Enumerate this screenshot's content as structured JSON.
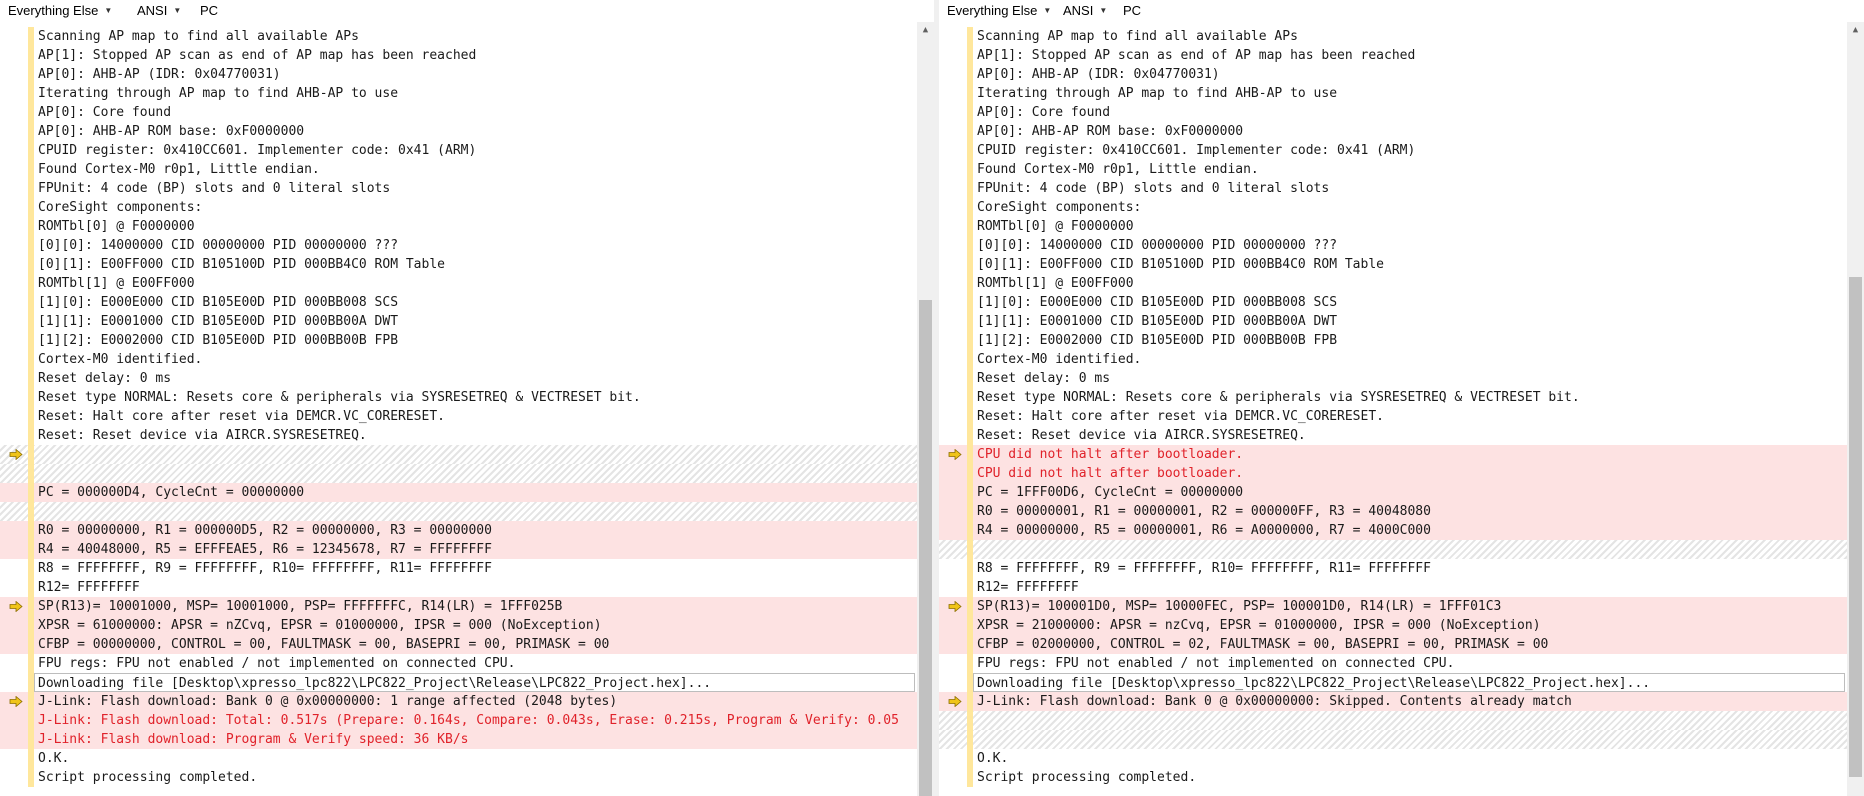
{
  "toolbar": {
    "items": [
      {
        "label": "Everything Else"
      },
      {
        "label": "ANSI"
      },
      {
        "label": "PC"
      }
    ]
  },
  "colors": {
    "marker": "#f0c419",
    "changed_bg": "#fde2e2",
    "changed_text": "#e0222a",
    "gutter_bar": "#ffe79c"
  },
  "left": {
    "lines": [
      {
        "t": "Scanning AP map to find all available APs"
      },
      {
        "t": "AP[1]: Stopped AP scan as end of AP map has been reached"
      },
      {
        "t": "AP[0]: AHB-AP (IDR: 0x04770031)"
      },
      {
        "t": "Iterating through AP map to find AHB-AP to use"
      },
      {
        "t": "AP[0]: Core found"
      },
      {
        "t": "AP[0]: AHB-AP ROM base: 0xF0000000"
      },
      {
        "t": "CPUID register: 0x410CC601. Implementer code: 0x41 (ARM)"
      },
      {
        "t": "Found Cortex-M0 r0p1, Little endian."
      },
      {
        "t": "FPUnit: 4 code (BP) slots and 0 literal slots"
      },
      {
        "t": "CoreSight components:"
      },
      {
        "t": "ROMTbl[0] @ F0000000"
      },
      {
        "t": "[0][0]: 14000000 CID 00000000 PID 00000000 ???"
      },
      {
        "t": "[0][1]: E00FF000 CID B105100D PID 000BB4C0 ROM Table"
      },
      {
        "t": "ROMTbl[1] @ E00FF000"
      },
      {
        "t": "[1][0]: E000E000 CID B105E00D PID 000BB008 SCS"
      },
      {
        "t": "[1][1]: E0001000 CID B105E00D PID 000BB00A DWT"
      },
      {
        "t": "[1][2]: E0002000 CID B105E00D PID 000BB00B FPB"
      },
      {
        "t": "Cortex-M0 identified."
      },
      {
        "t": "Reset delay: 0 ms"
      },
      {
        "t": "Reset type NORMAL: Resets core & peripherals via SYSRESETREQ & VECTRESET bit."
      },
      {
        "t": "Reset: Halt core after reset via DEMCR.VC_CORERESET."
      },
      {
        "t": "Reset: Reset device via AIRCR.SYSRESETREQ."
      },
      {
        "t": "",
        "kind": "hatched",
        "marker": true
      },
      {
        "t": "",
        "kind": "hatched"
      },
      {
        "t": "PC = 000000D4, CycleCnt = 00000000",
        "kind": "changed"
      },
      {
        "t": "",
        "kind": "hatched"
      },
      {
        "t": "R0 = 00000000, R1 = 000000D5, R2 = 00000000, R3 = 00000000",
        "kind": "changed"
      },
      {
        "t": "R4 = 40048000, R5 = EFFFEAE5, R6 = 12345678, R7 = FFFFFFFF",
        "kind": "changed"
      },
      {
        "t": "R8 = FFFFFFFF, R9 = FFFFFFFF, R10= FFFFFFFF, R11= FFFFFFFF"
      },
      {
        "t": "R12= FFFFFFFF"
      },
      {
        "t": "SP(R13)= 10001000, MSP= 10001000, PSP= FFFFFFFC, R14(LR) = 1FFF025B",
        "kind": "changed",
        "marker": true
      },
      {
        "t": "XPSR = 61000000: APSR = nZCvq, EPSR = 01000000, IPSR = 000 (NoException)",
        "kind": "changed"
      },
      {
        "t": "CFBP = 00000000, CONTROL = 00, FAULTMASK = 00, BASEPRI = 00, PRIMASK = 00",
        "kind": "changed"
      },
      {
        "t": "FPU regs: FPU not enabled / not implemented on connected CPU."
      },
      {
        "t": "Downloading file [Desktop\\xpresso_lpc822\\LPC822_Project\\Release\\LPC822_Project.hex]...",
        "kind": "box"
      },
      {
        "t": "J-Link: Flash download: Bank 0 @ 0x00000000: 1 range affected (2048 bytes)",
        "kind": "changed",
        "marker": true
      },
      {
        "t": "J-Link: Flash download: Total: 0.517s (Prepare: 0.164s, Compare: 0.043s, Erase: 0.215s, Program & Verify: 0.05",
        "kind": "changed",
        "red": true
      },
      {
        "t": "J-Link: Flash download: Program & Verify speed: 36 KB/s",
        "kind": "changed",
        "red": true
      },
      {
        "t": "O.K."
      },
      {
        "t": "Script processing completed."
      }
    ]
  },
  "right": {
    "lines": [
      {
        "t": "Scanning AP map to find all available APs"
      },
      {
        "t": "AP[1]: Stopped AP scan as end of AP map has been reached"
      },
      {
        "t": "AP[0]: AHB-AP (IDR: 0x04770031)"
      },
      {
        "t": "Iterating through AP map to find AHB-AP to use"
      },
      {
        "t": "AP[0]: Core found"
      },
      {
        "t": "AP[0]: AHB-AP ROM base: 0xF0000000"
      },
      {
        "t": "CPUID register: 0x410CC601. Implementer code: 0x41 (ARM)"
      },
      {
        "t": "Found Cortex-M0 r0p1, Little endian."
      },
      {
        "t": "FPUnit: 4 code (BP) slots and 0 literal slots"
      },
      {
        "t": "CoreSight components:"
      },
      {
        "t": "ROMTbl[0] @ F0000000"
      },
      {
        "t": "[0][0]: 14000000 CID 00000000 PID 00000000 ???"
      },
      {
        "t": "[0][1]: E00FF000 CID B105100D PID 000BB4C0 ROM Table"
      },
      {
        "t": "ROMTbl[1] @ E00FF000"
      },
      {
        "t": "[1][0]: E000E000 CID B105E00D PID 000BB008 SCS"
      },
      {
        "t": "[1][1]: E0001000 CID B105E00D PID 000BB00A DWT"
      },
      {
        "t": "[1][2]: E0002000 CID B105E00D PID 000BB00B FPB"
      },
      {
        "t": "Cortex-M0 identified."
      },
      {
        "t": "Reset delay: 0 ms"
      },
      {
        "t": "Reset type NORMAL: Resets core & peripherals via SYSRESETREQ & VECTRESET bit."
      },
      {
        "t": "Reset: Halt core after reset via DEMCR.VC_CORERESET."
      },
      {
        "t": "Reset: Reset device via AIRCR.SYSRESETREQ."
      },
      {
        "t": "CPU did not halt after bootloader.",
        "kind": "changed",
        "red": true,
        "marker": true
      },
      {
        "t": "CPU did not halt after bootloader.",
        "kind": "changed",
        "red": true
      },
      {
        "t": "PC = 1FFF00D6, CycleCnt = 00000000",
        "kind": "changed"
      },
      {
        "t": "R0 = 00000001, R1 = 00000001, R2 = 000000FF, R3 = 40048080",
        "kind": "changed"
      },
      {
        "t": "R4 = 00000000, R5 = 00000001, R6 = A0000000, R7 = 4000C000",
        "kind": "changed"
      },
      {
        "t": "",
        "kind": "hatched"
      },
      {
        "t": "R8 = FFFFFFFF, R9 = FFFFFFFF, R10= FFFFFFFF, R11= FFFFFFFF"
      },
      {
        "t": "R12= FFFFFFFF"
      },
      {
        "t": "SP(R13)= 100001D0, MSP= 10000FEC, PSP= 100001D0, R14(LR) = 1FFF01C3",
        "kind": "changed",
        "marker": true
      },
      {
        "t": "XPSR = 21000000: APSR = nzCvq, EPSR = 01000000, IPSR = 000 (NoException)",
        "kind": "changed"
      },
      {
        "t": "CFBP = 02000000, CONTROL = 02, FAULTMASK = 00, BASEPRI = 00, PRIMASK = 00",
        "kind": "changed"
      },
      {
        "t": "FPU regs: FPU not enabled / not implemented on connected CPU."
      },
      {
        "t": "Downloading file [Desktop\\xpresso_lpc822\\LPC822_Project\\Release\\LPC822_Project.hex]...",
        "kind": "box"
      },
      {
        "t": "J-Link: Flash download: Bank 0 @ 0x00000000: Skipped. Contents already match",
        "kind": "changed",
        "marker": true
      },
      {
        "t": "",
        "kind": "hatched"
      },
      {
        "t": "",
        "kind": "hatched"
      },
      {
        "t": "O.K."
      },
      {
        "t": "Script processing completed."
      }
    ]
  }
}
